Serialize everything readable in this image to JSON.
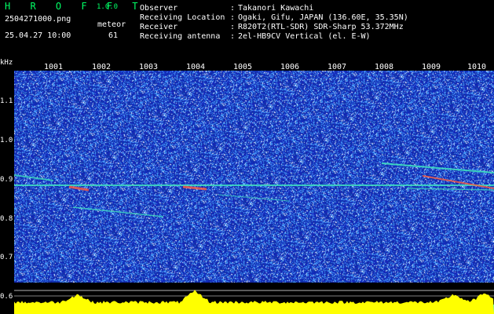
{
  "app": {
    "name": "H R O F F T",
    "version": "1.0.0"
  },
  "file": {
    "name": "2504271000.png",
    "datetime": "25.04.27 10:00"
  },
  "meteor": {
    "label": "meteor",
    "count": "61"
  },
  "station": {
    "rows": [
      {
        "label": "Observer",
        "value": "Takanori Kawachi"
      },
      {
        "label": "Receiving Location",
        "value": "Ogaki, Gifu, JAPAN (136.60E, 35.35N)"
      },
      {
        "label": "Receiver",
        "value": "R820T2(RTL-SDR) SDR-Sharp 53.372MHz"
      },
      {
        "label": "Receiving antenna",
        "value": "2el-HB9CV Vertical (el. E-W)"
      }
    ],
    "separator": ":"
  },
  "spectrogram": {
    "yaxis_unit": "kHz",
    "yticks": [
      "1.1",
      "1.0",
      "0.9",
      "0.8",
      "0.7",
      "0.6"
    ],
    "xticks": [
      "1001",
      "1002",
      "1003",
      "1004",
      "1005",
      "1006",
      "1007",
      "1008",
      "1009",
      "1010"
    ],
    "colors": {
      "background": "#0a1fa0",
      "noise_light": "#4aa0ff",
      "noise_white": "#e8f4ff",
      "carrier": "#40e0c0",
      "meteor_hot": "#ff6040",
      "histogram": "#ffff00",
      "baseline": "#00e5ff"
    }
  }
}
